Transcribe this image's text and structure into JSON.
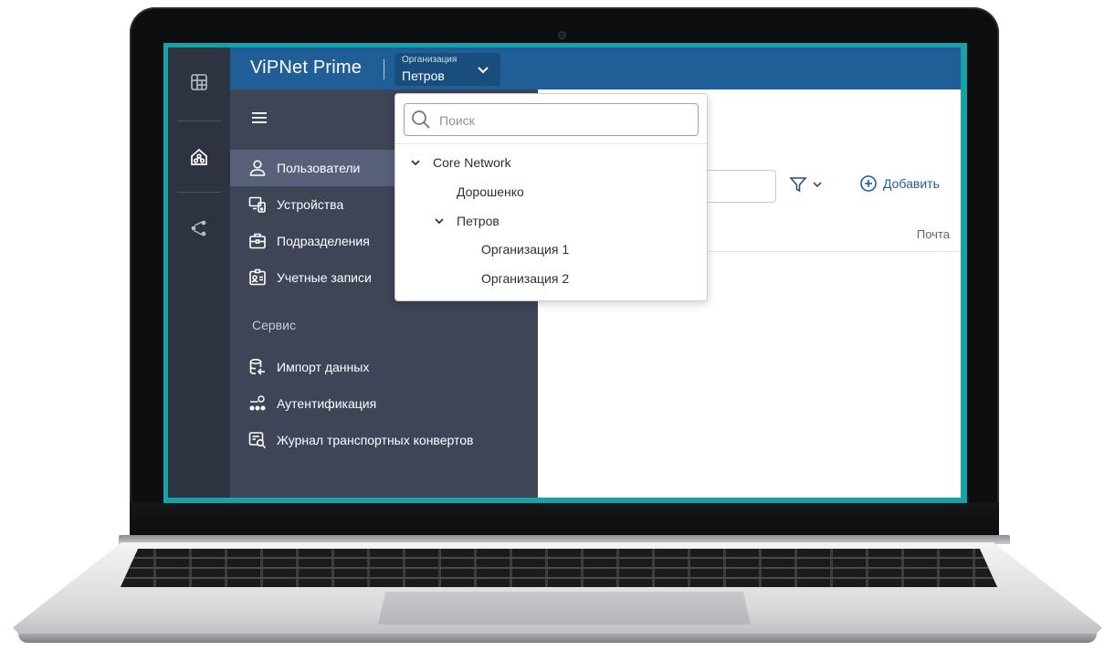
{
  "topbar": {
    "brand": "ViPNet Prime",
    "org_caption": "Организация",
    "org_value": "Петров"
  },
  "sidebar": {
    "items": [
      {
        "label": "Пользователи",
        "icon": "user-icon",
        "active": true
      },
      {
        "label": "Устройства",
        "icon": "devices-icon"
      },
      {
        "label": "Подразделения",
        "icon": "department-icon"
      },
      {
        "label": "Учетные записи",
        "icon": "id-card-icon"
      }
    ],
    "section_label": "Сервис",
    "service_items": [
      {
        "label": "Импорт данных",
        "icon": "import-data-icon"
      },
      {
        "label": "Аутентификация",
        "icon": "authentication-icon"
      },
      {
        "label": "Журнал транспортных конвертов",
        "icon": "envelope-log-icon"
      }
    ]
  },
  "main": {
    "add_label": "Добавить",
    "column_mail": "Почта"
  },
  "dropdown": {
    "search_placeholder": "Поиск",
    "tree": [
      {
        "label": "Core Network",
        "level": 0,
        "expanded": true
      },
      {
        "label": "Дорошенко",
        "level": 1
      },
      {
        "label": "Петров",
        "level": 1,
        "expanded": true
      },
      {
        "label": "Организация 1",
        "level": 2
      },
      {
        "label": "Организация 2",
        "level": 2
      }
    ]
  },
  "colors": {
    "topbar": "#1f5e97",
    "sidebar": "#3d4556",
    "rail": "#2d3341",
    "screen_border": "#17a1a8",
    "active_item": "#58607a"
  }
}
